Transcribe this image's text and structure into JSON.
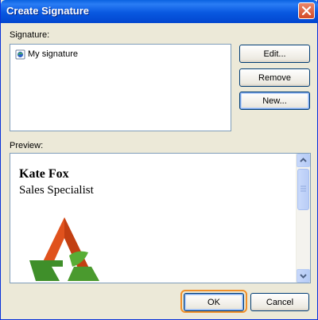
{
  "window": {
    "title": "Create Signature"
  },
  "signature_section": {
    "label": "Signature:",
    "items": [
      {
        "label": "My signature",
        "icon": "signature-icon"
      }
    ]
  },
  "side_buttons": {
    "edit_label": "Edit...",
    "remove_label": "Remove",
    "new_label": "New..."
  },
  "preview_section": {
    "label": "Preview:",
    "name": "Kate Fox",
    "job_title": "Sales Specialist",
    "logo_icon": "company-logo-icon"
  },
  "footer": {
    "ok_label": "OK",
    "cancel_label": "Cancel"
  },
  "colors": {
    "titlebar": "#0858e0",
    "dialog_bg": "#ece9d8",
    "focus_highlight": "#f0902a",
    "logo_orange": "#e0521d",
    "logo_green": "#4a9a2e"
  }
}
